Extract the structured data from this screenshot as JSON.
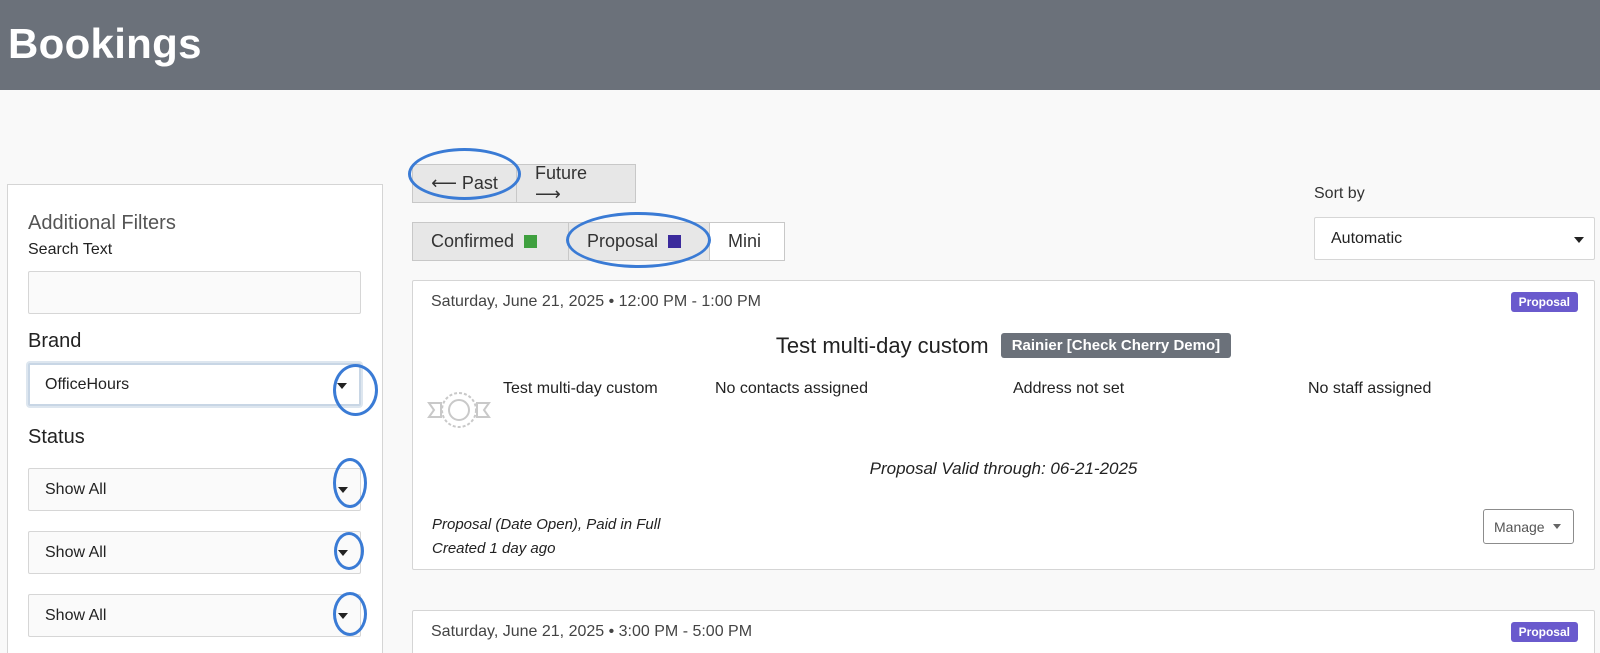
{
  "header": {
    "title": "Bookings"
  },
  "sidebar": {
    "title": "Additional Filters",
    "search_label": "Search Text",
    "search_value": "",
    "brand_label": "Brand",
    "brand_value": "OfficeHours",
    "status_label": "Status",
    "status_filters": [
      "Show All",
      "Show All",
      "Show All"
    ]
  },
  "nav": {
    "past": "⟵ Past",
    "future": "Future ⟶"
  },
  "view_toggles": [
    {
      "label": "Confirmed",
      "color": "#3fa03f"
    },
    {
      "label": "Proposal",
      "color": "#3b2a9c"
    },
    {
      "label": "Mini"
    }
  ],
  "sort": {
    "label": "Sort by",
    "value": "Automatic"
  },
  "bookings": [
    {
      "date": "Saturday, June 21, 2025 • 12:00 PM - 1:00 PM",
      "badge": "Proposal",
      "title": "Test multi-day custom",
      "location": "Rainier [Check Cherry Demo]",
      "package": "Test multi-day custom",
      "contacts": "No contacts assigned",
      "address": "Address not set",
      "staff": "No staff assigned",
      "valid_through": "Proposal Valid through: 06-21-2025",
      "status": "Proposal (Date Open), Paid in Full",
      "created": "Created 1 day ago",
      "manage_label": "Manage"
    },
    {
      "date": "Saturday, June 21, 2025 • 3:00 PM - 5:00 PM",
      "badge": "Proposal"
    }
  ],
  "colors": {
    "header_bg": "#6b717a",
    "badge_bg": "#6a5acd",
    "highlight_circle": "#3a7bd5"
  }
}
